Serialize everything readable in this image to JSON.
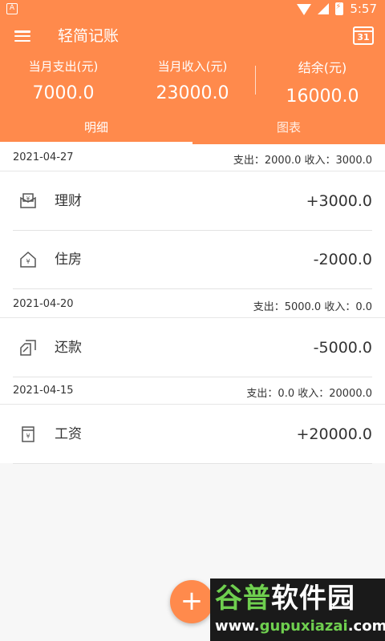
{
  "statusbar": {
    "time": "5:57",
    "notification_glyph": "A"
  },
  "header": {
    "title": "轻简记账",
    "calendar_day": "31",
    "summary": {
      "expense_label": "当月支出(元)",
      "expense_value": "7000.0",
      "income_label": "当月收入(元)",
      "income_value": "23000.0",
      "balance_label": "结余(元)",
      "balance_value": "16000.0"
    },
    "tabs": [
      {
        "label": "明细",
        "active": true
      },
      {
        "label": "图表",
        "active": false
      }
    ]
  },
  "groups": [
    {
      "date": "2021-04-27",
      "summary": "支出：2000.0 收入：3000.0",
      "entries": [
        {
          "category": "理财",
          "amount": "+3000.0",
          "icon": "wallet-icon"
        },
        {
          "category": "住房",
          "amount": "-2000.0",
          "icon": "house-icon"
        }
      ]
    },
    {
      "date": "2021-04-20",
      "summary": "支出：5000.0 收入：0.0",
      "entries": [
        {
          "category": "还款",
          "amount": "-5000.0",
          "icon": "repayment-icon"
        }
      ]
    },
    {
      "date": "2021-04-15",
      "summary": "支出：0.0 收入：20000.0",
      "entries": [
        {
          "category": "工资",
          "amount": "+20000.0",
          "icon": "salary-icon"
        }
      ]
    }
  ],
  "fab": {
    "label": "+"
  },
  "watermark": {
    "title_a": "谷普",
    "title_b": "软件园",
    "url_a": "www.",
    "url_b": "gupuxiazai",
    "url_c": ".com"
  },
  "colors": {
    "primary": "#ff8a4c",
    "text": "#333333",
    "divider": "#e3e3e3"
  }
}
